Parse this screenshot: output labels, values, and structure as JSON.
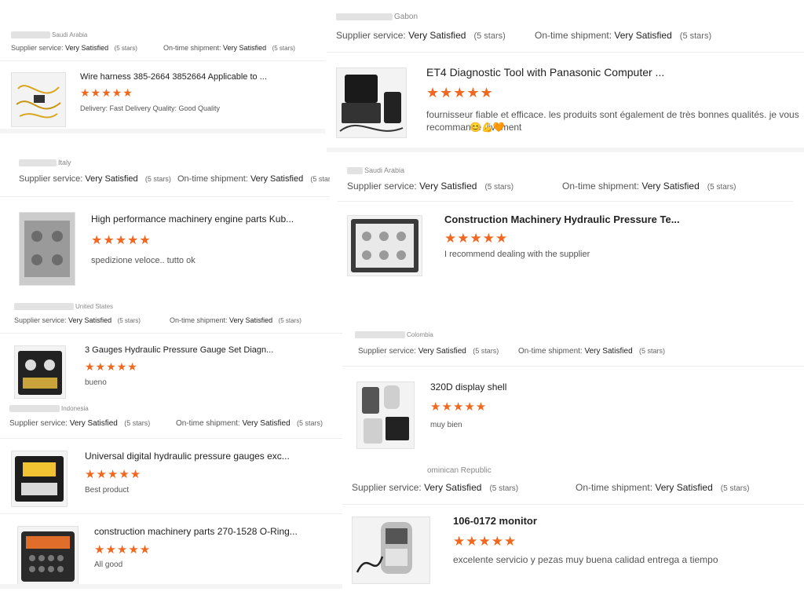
{
  "labels": {
    "supplier_service": "Supplier service:",
    "ontime_shipment": "On-time shipment:",
    "very_satisfied": "Very Satisfied",
    "five_stars": "(5 stars)",
    "stars": "★★★★★"
  },
  "reviews": [
    {
      "country": "Saudi Arabia",
      "title": "Wire harness 385-2664 3852664 Applicable to ...",
      "extra": "Delivery: Fast Delivery Quality: Good Quality"
    },
    {
      "country": "Italy",
      "title": "High performance machinery engine parts Kub...",
      "comment": "spedizione veloce.. tutto ok"
    },
    {
      "country": "United States",
      "title": "3 Gauges Hydraulic Pressure Gauge Set Diagn...",
      "comment": "bueno"
    },
    {
      "country": "Indonesia",
      "title": "Universal digital hydraulic pressure gauges exc...",
      "comment": "Best product"
    },
    {
      "title": "construction machinery parts 270-1528 O-Ring...",
      "comment": "All good"
    },
    {
      "country": "Gabon",
      "title": "ET4 Diagnostic Tool with Panasonic Computer ...",
      "comment": "fournisseur fiable et efficace. les produits sont également de très bonnes qualités. je vous recommande vivement",
      "emoji": "😊💪🧡"
    },
    {
      "country": "Saudi Arabia",
      "title": "Construction Machinery Hydraulic Pressure Te...",
      "comment": "I recommend dealing with the supplier"
    },
    {
      "country": "Colombia",
      "title": "320D display shell",
      "comment": "muy bien"
    },
    {
      "country": "ominican Republic",
      "title": "106-0172 monitor",
      "comment": "excelente servicio y pezas muy buena calidad entrega a tiempo"
    }
  ]
}
